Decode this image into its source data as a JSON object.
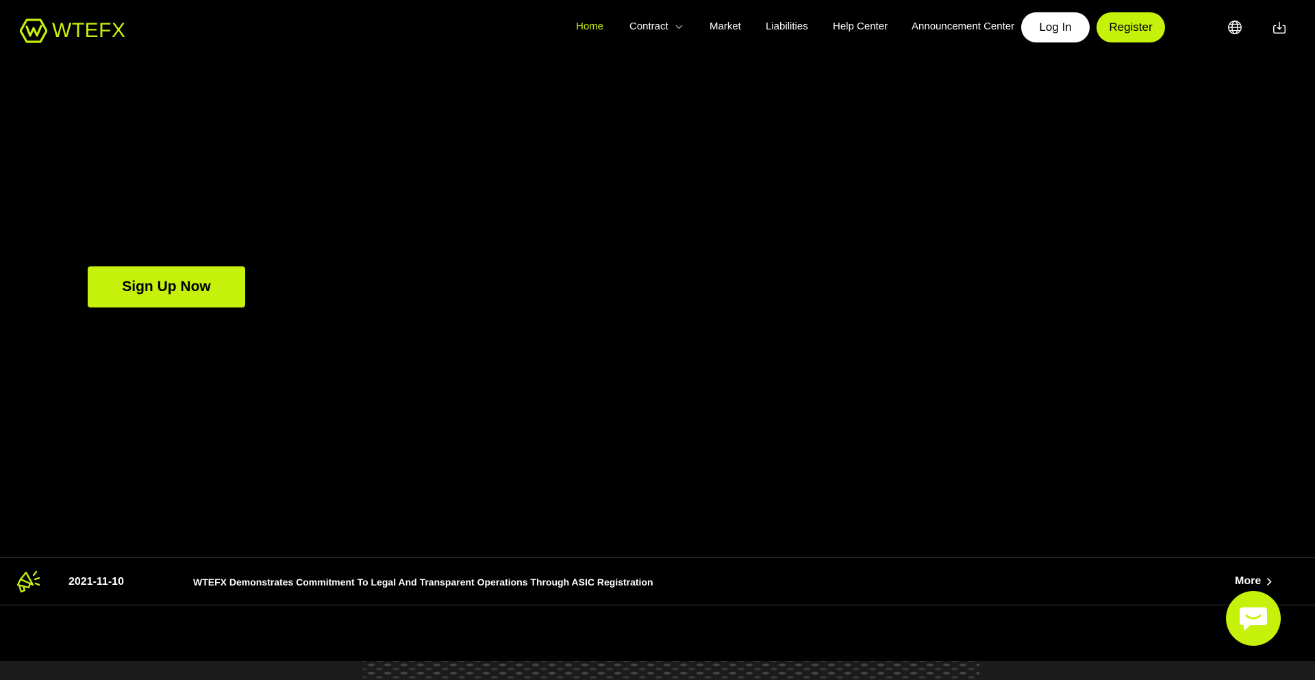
{
  "brand": {
    "name": "WTEFX",
    "accent": "#c6f10a",
    "logo_icon": "hexagon-w-logo-icon"
  },
  "nav": {
    "items": [
      {
        "label": "Home",
        "active": true
      },
      {
        "label": "Contract",
        "has_dropdown": true
      },
      {
        "label": "Market"
      },
      {
        "label": "Liabilities"
      },
      {
        "label": "Help Center"
      },
      {
        "label": "Announcement Center"
      }
    ],
    "login_label": "Log In",
    "register_label": "Register",
    "icons": [
      "globe-icon",
      "download-icon"
    ]
  },
  "hero": {
    "cta_label": "Sign Up Now"
  },
  "announcement": {
    "icon": "megaphone-icon",
    "date": "2021-11-10",
    "title": "WTEFX Demonstrates Commitment To Legal And Transparent Operations Through ASIC Registration",
    "more_label": "More"
  },
  "chat": {
    "icon": "chat-bubble-icon"
  }
}
